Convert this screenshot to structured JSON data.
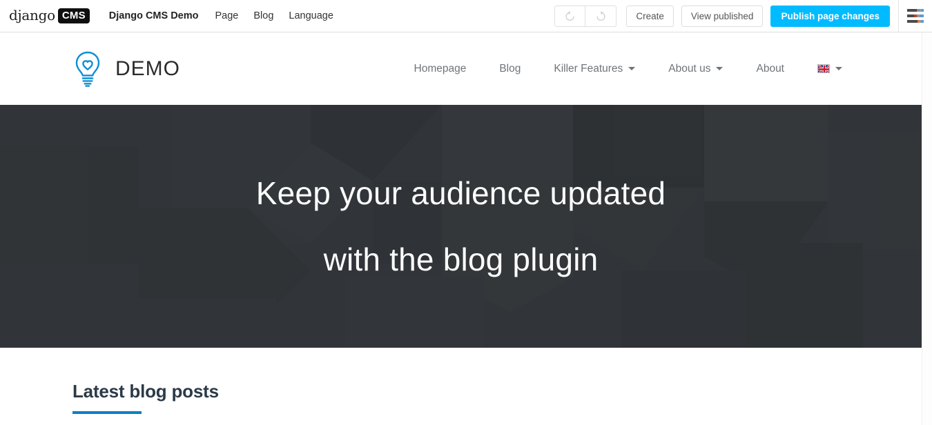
{
  "colors": {
    "toolbar_bg": "#ffffff",
    "primary_button": "#00bbff",
    "hero_bg": "#313438",
    "accent_rule": "#0b7fc7",
    "brand_blue": "#0c8fd4",
    "nav_text": "#6f7479",
    "section_title": "#2b3a48"
  },
  "toolbar": {
    "logo": {
      "word": "django",
      "badge": "CMS"
    },
    "menu": [
      {
        "label": "Django CMS Demo",
        "bold": true
      },
      {
        "label": "Page",
        "bold": false
      },
      {
        "label": "Blog",
        "bold": false
      },
      {
        "label": "Language",
        "bold": false
      }
    ],
    "history": [
      {
        "name": "undo-button",
        "icon": "undo-icon",
        "disabled": true
      },
      {
        "name": "redo-button",
        "icon": "redo-icon",
        "disabled": true
      }
    ],
    "buttons": {
      "create": "Create",
      "view_published": "View published",
      "publish": "Publish page changes"
    },
    "menu_toggle_icon": "hamburger-icon"
  },
  "site_header": {
    "logo_icon": "lightbulb-icon",
    "brand_name": "DEMO",
    "nav": [
      {
        "label": "Homepage",
        "has_dropdown": false
      },
      {
        "label": "Blog",
        "has_dropdown": false
      },
      {
        "label": "Killer Features",
        "has_dropdown": true
      },
      {
        "label": "About us",
        "has_dropdown": true
      },
      {
        "label": "About",
        "has_dropdown": false
      }
    ],
    "language_selector": {
      "icon": "uk-flag-icon",
      "has_dropdown": true
    }
  },
  "hero": {
    "line1": "Keep your audience updated",
    "line2": "with the blog plugin"
  },
  "content": {
    "section_title": "Latest blog posts"
  }
}
